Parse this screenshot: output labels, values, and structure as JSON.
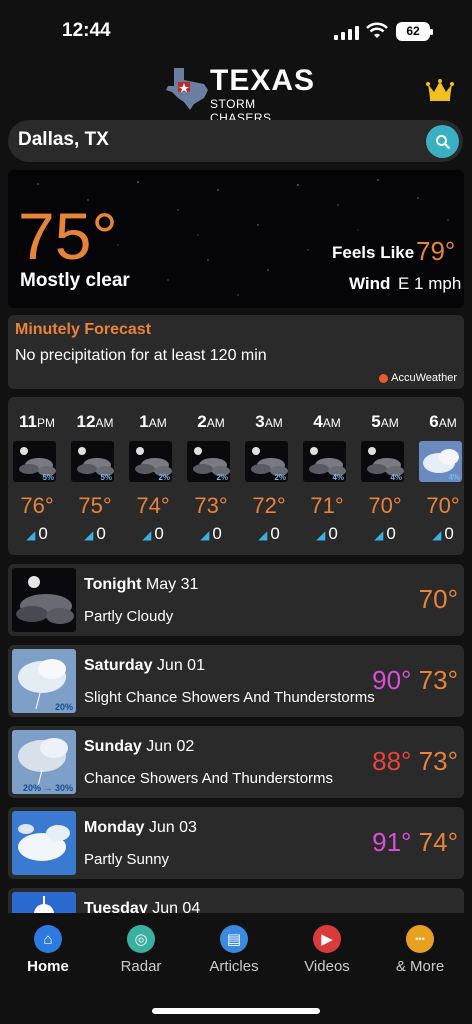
{
  "status": {
    "time": "12:44",
    "battery": "62"
  },
  "header": {
    "logo_title": "TEXAS",
    "logo_subtitle": "STORM CHASERS",
    "premium_icon": "crown-icon"
  },
  "search": {
    "city": "Dallas, TX",
    "icon": "search-icon"
  },
  "current": {
    "temp": "75°",
    "condition": "Mostly clear",
    "feels_like_label": "Feels Like",
    "feels_like_value": "79°",
    "wind_label": "Wind",
    "wind_value": "E 1 mph"
  },
  "minutely": {
    "title": "Minutely Forecast",
    "text": "No precipitation for at least 120 min",
    "provider": "AccuWeather"
  },
  "hourly": [
    {
      "hour": "11",
      "ampm": "PM",
      "pct": "5%",
      "temp": "76°",
      "wind": "0"
    },
    {
      "hour": "12",
      "ampm": "AM",
      "pct": "5%",
      "temp": "75°",
      "wind": "0"
    },
    {
      "hour": "1",
      "ampm": "AM",
      "pct": "2%",
      "temp": "74°",
      "wind": "0"
    },
    {
      "hour": "2",
      "ampm": "AM",
      "pct": "2%",
      "temp": "73°",
      "wind": "0"
    },
    {
      "hour": "3",
      "ampm": "AM",
      "pct": "2%",
      "temp": "72°",
      "wind": "0"
    },
    {
      "hour": "4",
      "ampm": "AM",
      "pct": "4%",
      "temp": "71°",
      "wind": "0"
    },
    {
      "hour": "5",
      "ampm": "AM",
      "pct": "4%",
      "temp": "70°",
      "wind": "0"
    },
    {
      "hour": "6",
      "ampm": "AM",
      "pct": "4%",
      "temp": "70°",
      "wind": "0"
    }
  ],
  "daily": [
    {
      "day": "Tonight",
      "date": "May 31",
      "condition": "Partly Cloudy",
      "hi": "",
      "lo": "70°",
      "hi_color": "",
      "lo_color": "#e8833a",
      "pct": ""
    },
    {
      "day": "Saturday",
      "date": "Jun 01",
      "condition": "Slight Chance Showers And Thunderstorms",
      "hi": "90°",
      "lo": "73°",
      "hi_color": "#d94fd9",
      "lo_color": "#e8833a",
      "pct": "20%"
    },
    {
      "day": "Sunday",
      "date": "Jun 02",
      "condition": "Chance Showers And Thunderstorms",
      "hi": "88°",
      "lo": "73°",
      "hi_color": "#e8453a",
      "lo_color": "#e8833a",
      "pct": "20% → 30%"
    },
    {
      "day": "Monday",
      "date": "Jun 03",
      "condition": "Partly Sunny",
      "hi": "91°",
      "lo": "74°",
      "hi_color": "#d94fd9",
      "lo_color": "#e8833a",
      "pct": ""
    },
    {
      "day": "Tuesday",
      "date": "Jun 04",
      "condition": "",
      "hi": "",
      "lo": "",
      "hi_color": "#d94fd9",
      "lo_color": "#e8833a",
      "pct": ""
    }
  ],
  "nav": [
    {
      "label": "Home",
      "icon": "home-icon",
      "color": "#2d7be0"
    },
    {
      "label": "Radar",
      "icon": "radar-icon",
      "color": "#3ab0a0"
    },
    {
      "label": "Articles",
      "icon": "articles-icon",
      "color": "#3a8ae0"
    },
    {
      "label": "Videos",
      "icon": "video-icon",
      "color": "#d93a3a"
    },
    {
      "label": "& More",
      "icon": "more-icon",
      "color": "#e8a020"
    }
  ]
}
